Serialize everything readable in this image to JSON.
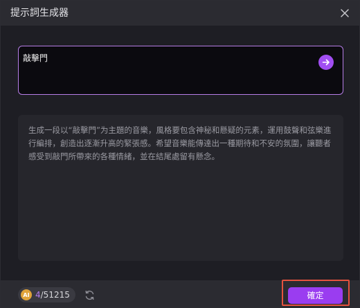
{
  "dialog": {
    "title": "提示詞生成器",
    "close_icon": "close-icon"
  },
  "prompt": {
    "value": "敲擊門",
    "submit_icon": "arrow-right-icon",
    "accent_color": "#a14ef2",
    "border_color": "#b77ee8"
  },
  "result": {
    "text": "生成一段以“敲擊門”为主題的音樂，風格要包含神秘和懸疑的元素，運用鼓聲和弦樂進行編排，創造出逐漸升高的緊張感。希望音樂能傳達出一種期待和不安的氛圍，讓聽者感受到敲門所帶來的各種情緒，並在結尾處留有懸念。"
  },
  "footer": {
    "coin_label": "AI",
    "credits_used": "4",
    "credits_total": "/51215",
    "refresh_icon": "refresh-icon",
    "confirm_label": "確定",
    "highlight_color": "#e6523e"
  }
}
